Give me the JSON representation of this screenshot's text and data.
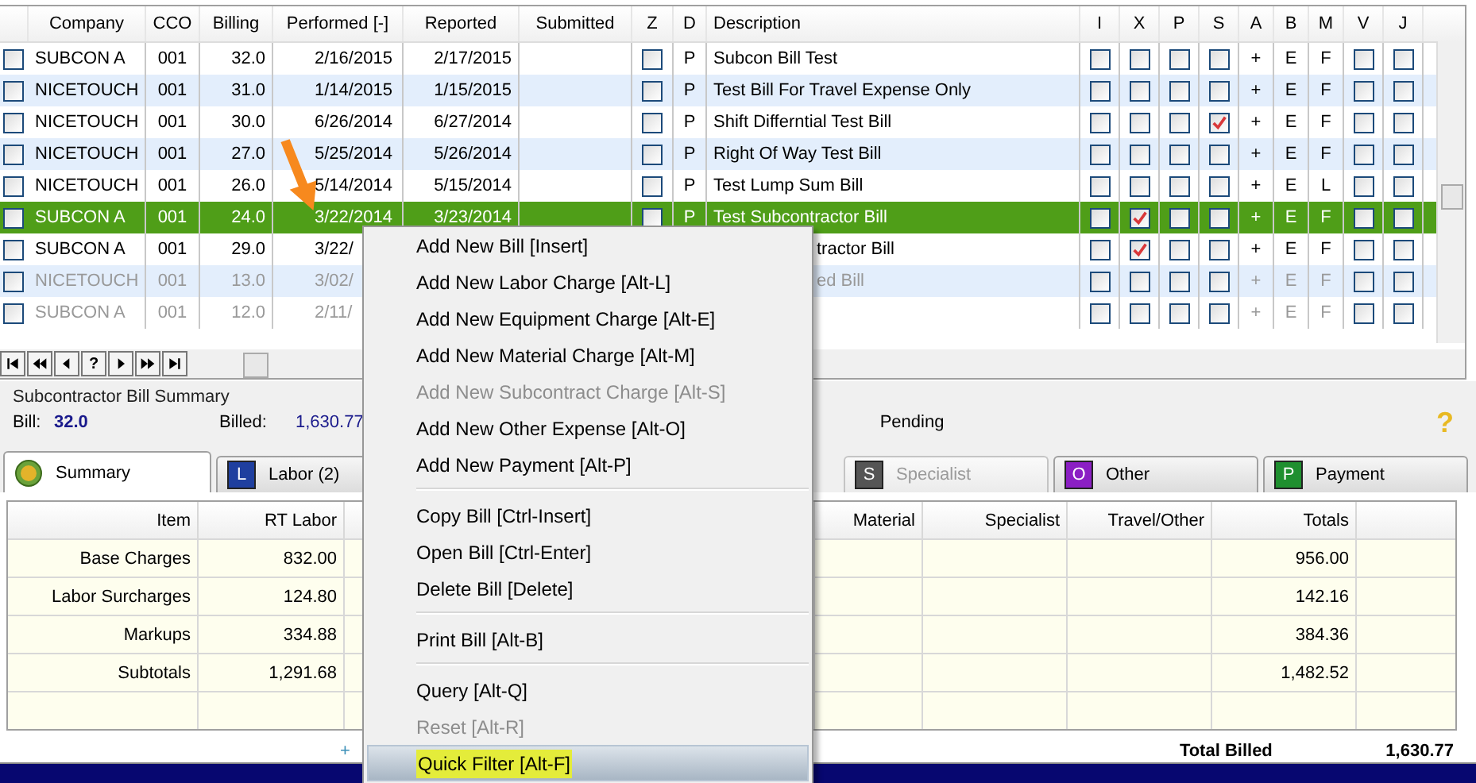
{
  "grid": {
    "columns": [
      "Company",
      "CCO",
      "Billing",
      "Performed [-]",
      "Reported",
      "Submitted",
      "Z",
      "D",
      "Description",
      "I",
      "X",
      "P",
      "S",
      "A",
      "B",
      "M",
      "V",
      "J"
    ],
    "rows": [
      {
        "selected": false,
        "dimmed": false,
        "under_menu": false,
        "company": "SUBCON A",
        "cco": "001",
        "billing": "32.0",
        "performed": "2/16/2015",
        "reported": "2/17/2015",
        "z": false,
        "d": "P",
        "description": "Subcon Bill Test",
        "i": false,
        "x": false,
        "p": false,
        "s": false,
        "a": "+",
        "b": "E",
        "m": "F",
        "v": false,
        "j": false
      },
      {
        "selected": false,
        "dimmed": false,
        "under_menu": false,
        "company": "NICETOUCH",
        "cco": "001",
        "billing": "31.0",
        "performed": "1/14/2015",
        "reported": "1/15/2015",
        "z": false,
        "d": "P",
        "description": "Test Bill For Travel Expense Only",
        "i": false,
        "x": false,
        "p": false,
        "s": false,
        "a": "+",
        "b": "E",
        "m": "F",
        "v": false,
        "j": false
      },
      {
        "selected": false,
        "dimmed": false,
        "under_menu": false,
        "company": "NICETOUCH",
        "cco": "001",
        "billing": "30.0",
        "performed": "6/26/2014",
        "reported": "6/27/2014",
        "z": false,
        "d": "P",
        "description": "Shift Differntial Test Bill",
        "i": false,
        "x": false,
        "p": false,
        "s": true,
        "a": "+",
        "b": "E",
        "m": "F",
        "v": false,
        "j": false
      },
      {
        "selected": false,
        "dimmed": false,
        "under_menu": false,
        "company": "NICETOUCH",
        "cco": "001",
        "billing": "27.0",
        "performed": "5/25/2014",
        "reported": "5/26/2014",
        "z": false,
        "d": "P",
        "description": "Right Of Way Test Bill",
        "i": false,
        "x": false,
        "p": false,
        "s": false,
        "a": "+",
        "b": "E",
        "m": "F",
        "v": false,
        "j": false
      },
      {
        "selected": false,
        "dimmed": false,
        "under_menu": false,
        "company": "NICETOUCH",
        "cco": "001",
        "billing": "26.0",
        "performed": "5/14/2014",
        "reported": "5/15/2014",
        "z": false,
        "d": "P",
        "description": "Test Lump Sum Bill",
        "i": false,
        "x": false,
        "p": false,
        "s": false,
        "a": "+",
        "b": "E",
        "m": "L",
        "v": false,
        "j": false
      },
      {
        "selected": true,
        "dimmed": false,
        "under_menu": false,
        "company": "SUBCON A",
        "cco": "001",
        "billing": "24.0",
        "performed": "3/22/2014",
        "reported": "3/23/2014",
        "z": false,
        "d": "P",
        "description": "Test Subcontractor Bill",
        "i": false,
        "x": true,
        "p": false,
        "s": false,
        "a": "+",
        "b": "E",
        "m": "F",
        "v": false,
        "j": false
      },
      {
        "selected": false,
        "dimmed": false,
        "under_menu": true,
        "company": "SUBCON A",
        "cco": "001",
        "billing": "29.0",
        "performed": "3/22/",
        "description": "tractor Bill",
        "i": false,
        "x": true,
        "p": false,
        "s": false,
        "a": "+",
        "b": "E",
        "m": "F",
        "v": false,
        "j": false
      },
      {
        "selected": false,
        "dimmed": true,
        "under_menu": true,
        "company": "NICETOUCH",
        "cco": "001",
        "billing": "13.0",
        "performed": "3/02/",
        "description": "ed Bill",
        "i": false,
        "x": false,
        "p": false,
        "s": false,
        "a": "+",
        "b": "E",
        "m": "F",
        "v": false,
        "j": false
      },
      {
        "selected": false,
        "dimmed": true,
        "under_menu": true,
        "company": "SUBCON A",
        "cco": "001",
        "billing": "12.0",
        "performed": "2/11/",
        "i": false,
        "x": false,
        "p": false,
        "s": false,
        "a": "+",
        "b": "E",
        "m": "F",
        "v": false,
        "j": false
      }
    ],
    "nav_buttons": [
      {
        "kind": "first"
      },
      {
        "kind": "prev-page"
      },
      {
        "kind": "prev"
      },
      {
        "kind": "help",
        "label": "?"
      },
      {
        "kind": "next"
      },
      {
        "kind": "next-page"
      },
      {
        "kind": "last"
      }
    ]
  },
  "summary": {
    "title": "Subcontractor Bill Summary",
    "bill_label": "Bill:",
    "bill": "32.0",
    "billed_label": "Billed:",
    "billed": "1,630.77",
    "pending": "Pending",
    "help": "?"
  },
  "tabs": [
    {
      "label": "Summary",
      "kind": "coin",
      "selected": true,
      "disabled": false
    },
    {
      "label": "Labor (2)",
      "kind": "badge",
      "badge": "L",
      "color": "#1f3f9f",
      "selected": false,
      "disabled": false
    },
    {
      "label": "Specialist",
      "kind": "badge",
      "badge": "S",
      "color": "#555555",
      "selected": false,
      "disabled": true
    },
    {
      "label": "Other",
      "kind": "badge",
      "badge": "O",
      "color": "#8b1fc4",
      "selected": false,
      "disabled": false
    },
    {
      "label": "Payment",
      "kind": "badge",
      "badge": "P",
      "color": "#1f8f2f",
      "selected": false,
      "disabled": false
    }
  ],
  "table": {
    "columns": [
      "Item",
      "RT Labor",
      "Material",
      "Specialist",
      "Travel/Other",
      "Totals"
    ],
    "rows": [
      [
        "Base Charges",
        "832.00",
        null,
        null,
        null,
        "956.00"
      ],
      [
        "Labor Surcharges",
        "124.80",
        null,
        null,
        null,
        "142.16"
      ],
      [
        "Markups",
        "334.88",
        null,
        null,
        null,
        "384.36"
      ],
      [
        "Subtotals",
        "1,291.68",
        null,
        null,
        null,
        "1,482.52"
      ],
      [
        null,
        null,
        null,
        null,
        null,
        null
      ]
    ],
    "expand": "+",
    "total_label": "Total Billed",
    "total": "1,630.77"
  },
  "context_menu": [
    {
      "kind": "item",
      "label": "Add New Bill [Insert]",
      "disabled": false,
      "highlighted": false
    },
    {
      "kind": "item",
      "label": "Add New Labor Charge [Alt-L]",
      "disabled": false,
      "highlighted": false
    },
    {
      "kind": "item",
      "label": "Add New Equipment Charge [Alt-E]",
      "disabled": false,
      "highlighted": false
    },
    {
      "kind": "item",
      "label": "Add New Material Charge [Alt-M]",
      "disabled": false,
      "highlighted": false
    },
    {
      "kind": "item",
      "label": "Add New Subcontract Charge [Alt-S]",
      "disabled": true,
      "highlighted": false
    },
    {
      "kind": "item",
      "label": "Add New Other Expense [Alt-O]",
      "disabled": false,
      "highlighted": false
    },
    {
      "kind": "item",
      "label": "Add New Payment [Alt-P]",
      "disabled": false,
      "highlighted": false
    },
    {
      "kind": "separator"
    },
    {
      "kind": "item",
      "label": "Copy Bill [Ctrl-Insert]",
      "disabled": false,
      "highlighted": false
    },
    {
      "kind": "item",
      "label": "Open Bill [Ctrl-Enter]",
      "disabled": false,
      "highlighted": false
    },
    {
      "kind": "item",
      "label": "Delete Bill [Delete]",
      "disabled": false,
      "highlighted": false
    },
    {
      "kind": "separator"
    },
    {
      "kind": "item",
      "label": "Print Bill [Alt-B]",
      "disabled": false,
      "highlighted": false
    },
    {
      "kind": "separator"
    },
    {
      "kind": "item",
      "label": "Query [Alt-Q]",
      "disabled": false,
      "highlighted": false
    },
    {
      "kind": "item",
      "label": "Reset [Alt-R]",
      "disabled": true,
      "highlighted": false
    },
    {
      "kind": "item",
      "label": "Quick Filter [Alt-F]",
      "disabled": false,
      "highlighted": true
    }
  ]
}
